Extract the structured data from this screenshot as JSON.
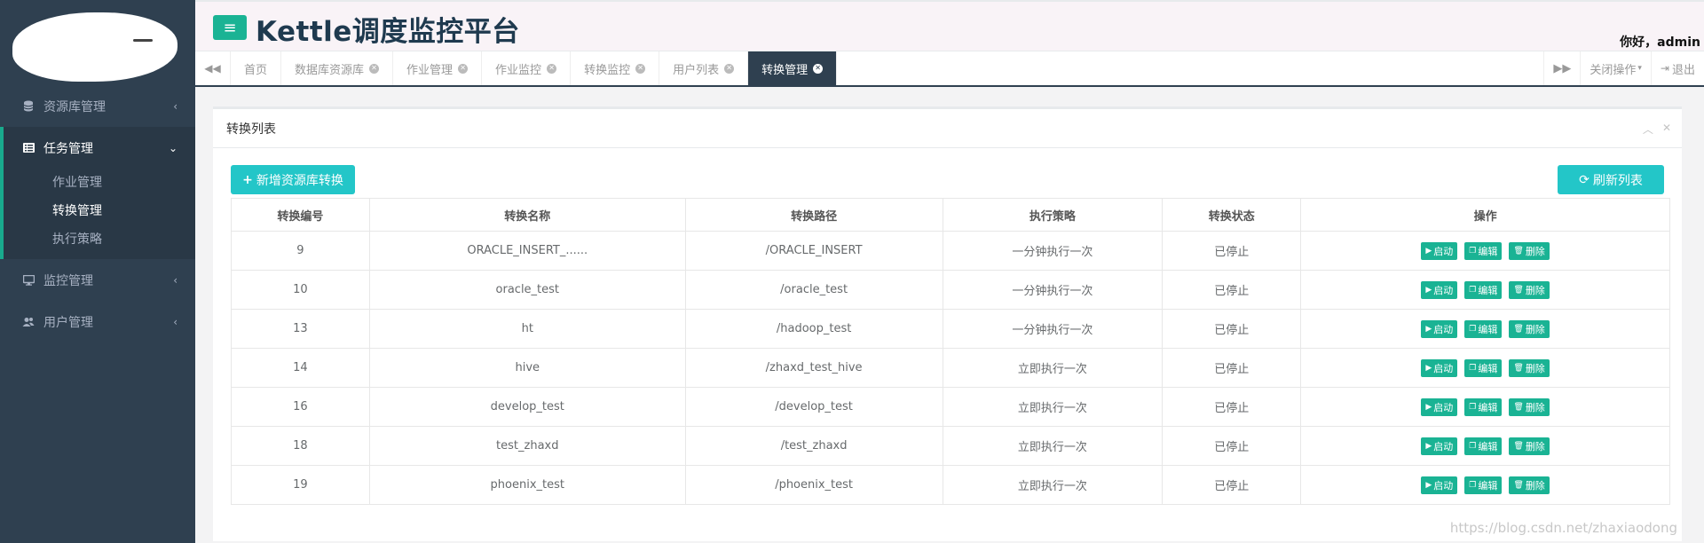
{
  "app": {
    "title": "Kettle调度监控平台",
    "greeting": "你好，admin"
  },
  "sidebar": {
    "items": [
      {
        "label": "资源库管理",
        "icon": "database-icon"
      },
      {
        "label": "任务管理",
        "icon": "tasks-icon",
        "children": [
          "作业管理",
          "转换管理",
          "执行策略"
        ]
      },
      {
        "label": "监控管理",
        "icon": "monitor-icon"
      },
      {
        "label": "用户管理",
        "icon": "users-icon"
      }
    ]
  },
  "tabs": [
    "首页",
    "数据库资源库",
    "作业管理",
    "作业监控",
    "转换监控",
    "用户列表",
    "转换管理"
  ],
  "tab_right": {
    "close_ops": "关闭操作",
    "logout": "退出"
  },
  "panel": {
    "title": "转换列表",
    "add_button": "新增资源库转换",
    "refresh_button": "刷新列表"
  },
  "table": {
    "headers": [
      "转换编号",
      "转换名称",
      "转换路径",
      "执行策略",
      "转换状态",
      "操作"
    ],
    "rows": [
      [
        "9",
        "ORACLE_INSERT_......",
        "/ORACLE_INSERT",
        "一分钟执行一次",
        "已停止"
      ],
      [
        "10",
        "oracle_test",
        "/oracle_test",
        "一分钟执行一次",
        "已停止"
      ],
      [
        "13",
        "ht",
        "/hadoop_test",
        "一分钟执行一次",
        "已停止"
      ],
      [
        "14",
        "hive",
        "/zhaxd_test_hive",
        "立即执行一次",
        "已停止"
      ],
      [
        "16",
        "develop_test",
        "/develop_test",
        "立即执行一次",
        "已停止"
      ],
      [
        "18",
        "test_zhaxd",
        "/test_zhaxd",
        "立即执行一次",
        "已停止"
      ],
      [
        "19",
        "phoenix_test",
        "/phoenix_test",
        "立即执行一次",
        "已停止"
      ]
    ],
    "actions": {
      "start": "启动",
      "edit": "编辑",
      "delete": "删除"
    }
  },
  "watermark": "https://blog.csdn.net/zhaxiaodong",
  "colors": {
    "sidebar": "#2f4050",
    "primary": "#1ab394",
    "info": "#23c6c8"
  }
}
